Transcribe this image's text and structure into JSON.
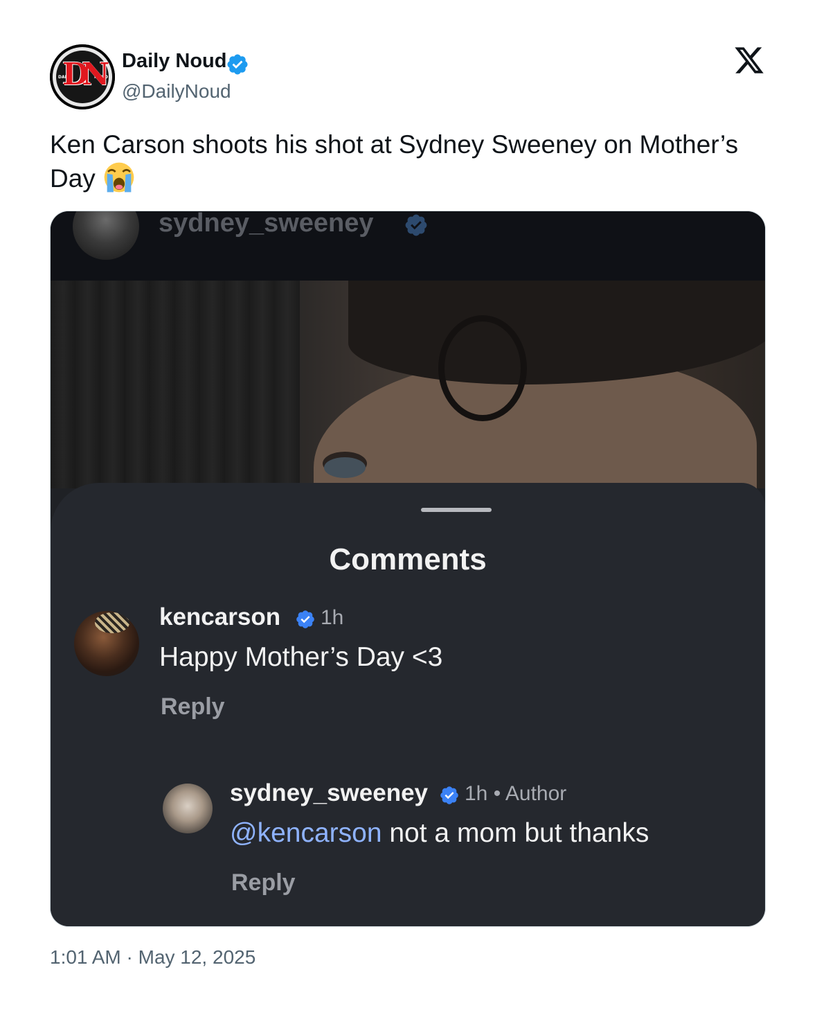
{
  "author": {
    "name": "Daily Noud",
    "handle": "@DailyNoud",
    "avatar_letters": "DN",
    "avatar_side_left": "DAILY",
    "avatar_side_right": "NOUD",
    "verified": true
  },
  "tweet": {
    "text": "Ken Carson shoots his shot at Sydney Sweeney on Mother’s Day",
    "emoji": "loudly-crying-face",
    "timestamp": "1:01 AM · May 12, 2025"
  },
  "media": {
    "top_username": "sydney_sweeney",
    "sheet_title": "Comments",
    "comments": [
      {
        "username": "kencarson",
        "time": "1h",
        "text": "Happy Mother’s Day <3",
        "reply_label": "Reply"
      },
      {
        "username": "sydney_sweeney",
        "time": "1h",
        "author_tag": "• Author",
        "mention": "@kencarson",
        "text": " not a mom but thanks",
        "reply_label": "Reply"
      }
    ]
  },
  "colors": {
    "verified_blue": "#1d9bf0",
    "sheet_bg": "#25282e",
    "mention_blue": "#8fb3ff",
    "handle_gray": "#536471"
  }
}
